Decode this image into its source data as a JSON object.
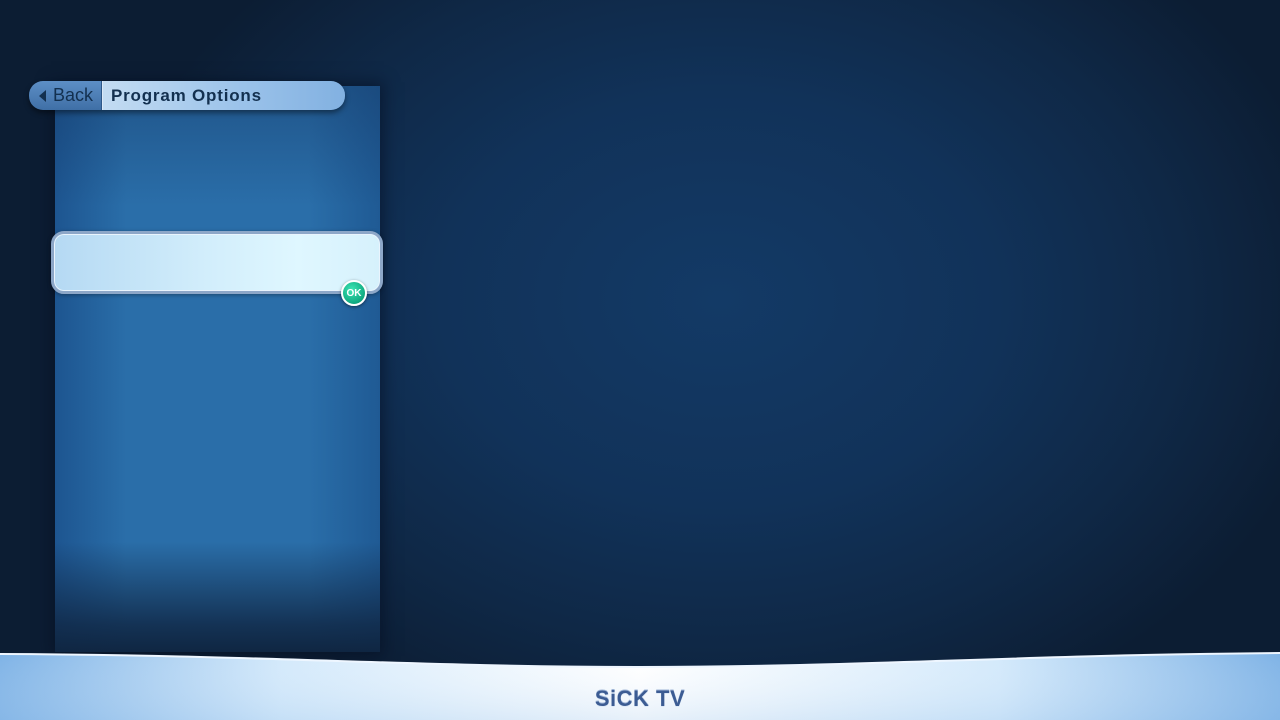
{
  "header": {
    "back_label": "Back",
    "title": "Program Options"
  },
  "menu": {
    "items": [
      {
        "label": ""
      }
    ],
    "ok_label": "OK"
  },
  "footer": {
    "logo_text": "SiCK TV"
  },
  "colors": {
    "background": "#113259",
    "panel": "#2a6ea9",
    "header_text": "#13304f",
    "ok_badge": "#0fa980",
    "logo": "#3c5c93"
  },
  "icons": {
    "back": "chevron-left-icon"
  }
}
